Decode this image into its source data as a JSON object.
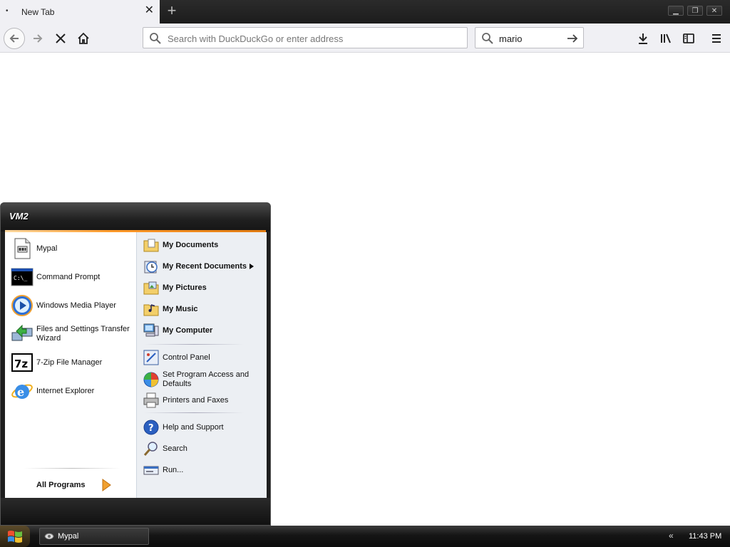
{
  "browser": {
    "tab_title": "New Tab",
    "tab_dot": "•",
    "close_tab": "✕",
    "new_tab": "+",
    "url_placeholder": "Search with DuckDuckGo or enter address",
    "search_value": "mario",
    "window_buttons": {
      "minimize": "▁",
      "restore": "❐",
      "close": "✕"
    }
  },
  "start_menu": {
    "user": "VM2",
    "programs": [
      {
        "label": "Mypal",
        "icon": "mypal-icon"
      },
      {
        "label": "Command Prompt",
        "icon": "command-prompt-icon"
      },
      {
        "label": "Windows Media Player",
        "icon": "media-player-icon"
      },
      {
        "label": "Files and Settings Transfer Wizard",
        "icon": "transfer-wizard-icon"
      },
      {
        "label": "7-Zip File Manager",
        "icon": "7zip-icon"
      },
      {
        "label": "Internet Explorer",
        "icon": "internet-explorer-icon"
      }
    ],
    "all_programs": "All Programs",
    "places": [
      {
        "label": "My Documents",
        "icon": "folder-icon"
      },
      {
        "label": "My Recent Documents",
        "icon": "recent-documents-icon"
      },
      {
        "label": "My Pictures",
        "icon": "folder-pictures-icon"
      },
      {
        "label": "My Music",
        "icon": "folder-music-icon"
      },
      {
        "label": "My Computer",
        "icon": "computer-icon"
      }
    ],
    "system": [
      {
        "label": "Control Panel",
        "icon": "control-panel-icon"
      },
      {
        "label": "Set Program Access and Defaults",
        "icon": "program-access-icon"
      },
      {
        "label": "Printers and Faxes",
        "icon": "printer-icon"
      }
    ],
    "support": [
      {
        "label": "Help and Support",
        "icon": "help-icon"
      },
      {
        "label": "Search",
        "icon": "search-icon"
      },
      {
        "label": "Run...",
        "icon": "run-icon"
      }
    ]
  },
  "taskbar": {
    "task_label": "Mypal",
    "tray_arrow": "«",
    "clock": "11:43 PM"
  },
  "colors": {
    "accent_orange": "#ff9a2a",
    "help_blue": "#2a5fc0",
    "folder_yellow": "#f3cf6a"
  }
}
